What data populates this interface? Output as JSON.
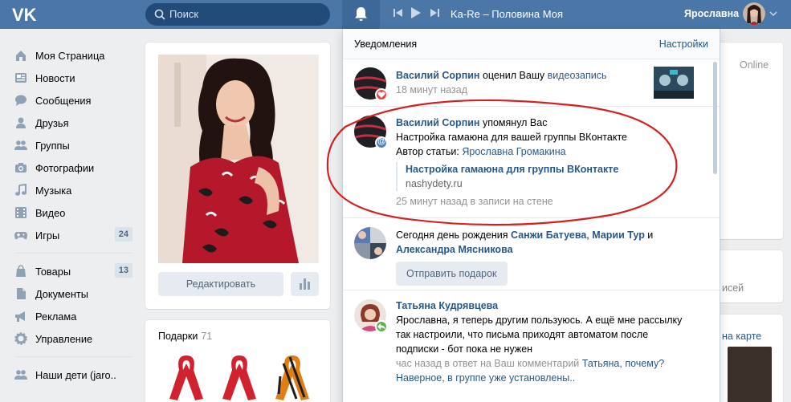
{
  "header": {
    "logo": "vk-logo",
    "search_placeholder": "Поиск",
    "track": "Ka-Re – Половина Моя",
    "user_name": "Ярославна"
  },
  "sidebar": {
    "items": [
      {
        "label": "Моя Страница",
        "icon": "home-icon"
      },
      {
        "label": "Новости",
        "icon": "news-icon"
      },
      {
        "label": "Сообщения",
        "icon": "messages-icon"
      },
      {
        "label": "Друзья",
        "icon": "friends-icon"
      },
      {
        "label": "Группы",
        "icon": "groups-icon"
      },
      {
        "label": "Фотографии",
        "icon": "camera-icon"
      },
      {
        "label": "Музыка",
        "icon": "music-icon"
      },
      {
        "label": "Видео",
        "icon": "video-icon"
      },
      {
        "label": "Игры",
        "icon": "games-icon",
        "count": "24"
      }
    ],
    "items2": [
      {
        "label": "Товары",
        "icon": "goods-icon",
        "count": "13"
      },
      {
        "label": "Документы",
        "icon": "documents-icon"
      },
      {
        "label": "Реклама",
        "icon": "ads-icon"
      },
      {
        "label": "Управление",
        "icon": "manage-icon"
      }
    ],
    "items3": [
      {
        "label": "Наши дети (jaro..",
        "icon": "community-icon"
      }
    ]
  },
  "profile": {
    "edit_label": "Редактировать",
    "gifts_label": "Подарки",
    "gifts_count": "71"
  },
  "right": {
    "online": "Online",
    "peek1": "исей",
    "peek2": "на карте"
  },
  "notifications": {
    "title": "Уведомления",
    "settings": "Настройки",
    "n1": {
      "author": "Василий Сорпин",
      "text": " оценил Вашу ",
      "link": "видеозапись",
      "time": "18 минут назад"
    },
    "n2": {
      "author": "Василий Сорпин",
      "text": " упомянул Вас",
      "line2": "Настройка гамаюна для вашей группы ВКонтакте",
      "line3_prefix": "Автор статьи: ",
      "line3_link": "Ярославна Громакина",
      "quote_title": "Настройка гамаюна для группы ВКонтакте",
      "quote_site": "nashydety.ru",
      "time": "25 минут назад в записи на стене"
    },
    "n3": {
      "prefix": "Сегодня день рождения ",
      "name1": "Санжи Батуева",
      "sep1": ", ",
      "name2": "Марии Тур",
      "sep2": " и",
      "name3": "Александра Мясникова",
      "button": "Отправить подарок"
    },
    "n4": {
      "author": "Татьяна Кудрявцева",
      "text": "Ярославна, я теперь другим пользуюсь. А ещё мне рассылку так настроили, что письма приходят автоматом после подписки - бот пока не нужен",
      "meta": "час назад в ответ на Ваш комментарий ",
      "meta_link": "Татьяна, почему? Наверное, в группе уже установлены.."
    }
  },
  "colors": {
    "header": "#4a76a8",
    "link": "#2a5885",
    "bg": "#edeef0",
    "annotation_red": "#d42020"
  }
}
